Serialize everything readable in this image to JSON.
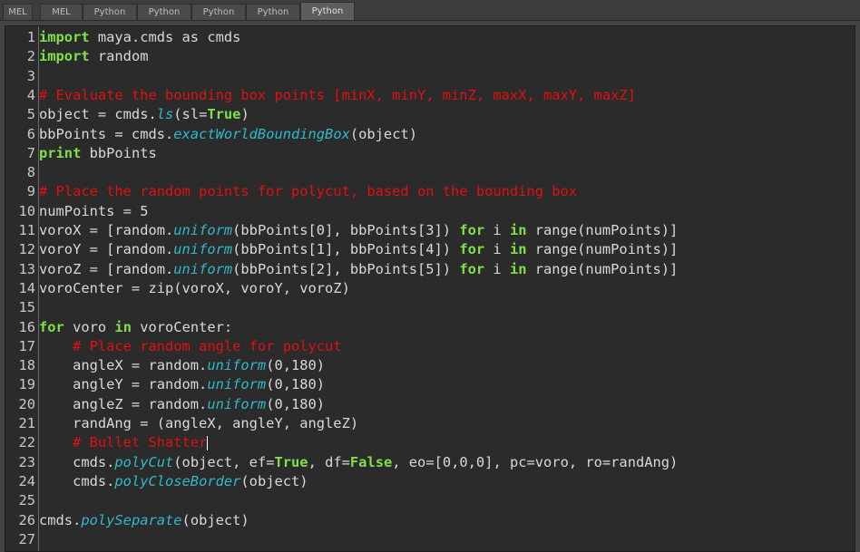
{
  "tabs": [
    {
      "label": "MEL"
    },
    {
      "label": "MEL"
    },
    {
      "label": "Python"
    },
    {
      "label": "Python"
    },
    {
      "label": "Python"
    },
    {
      "label": "Python"
    },
    {
      "label": "Python"
    }
  ],
  "active_tab_index": 6,
  "colors": {
    "keyword": "#7fe049",
    "comment": "#e01010",
    "function": "#2fb9c9",
    "text": "#d9d9d9",
    "background": "#2b2b2b"
  },
  "editor": {
    "lines": [
      {
        "num": "1",
        "tokens": [
          {
            "t": "kw",
            "v": "import"
          },
          {
            "t": "tx",
            "v": " maya.cmds as cmds"
          }
        ]
      },
      {
        "num": "2",
        "tokens": [
          {
            "t": "kw",
            "v": "import"
          },
          {
            "t": "tx",
            "v": " random"
          }
        ]
      },
      {
        "num": "3",
        "tokens": []
      },
      {
        "num": "4",
        "tokens": [
          {
            "t": "cm",
            "v": "# Evaluate the bounding box points [minX, minY, minZ, maxX, maxY, maxZ]"
          }
        ]
      },
      {
        "num": "5",
        "tokens": [
          {
            "t": "tx",
            "v": "object = cmds."
          },
          {
            "t": "fn",
            "v": "ls"
          },
          {
            "t": "tx",
            "v": "(sl="
          },
          {
            "t": "kw",
            "v": "True"
          },
          {
            "t": "tx",
            "v": ")"
          }
        ]
      },
      {
        "num": "6",
        "tokens": [
          {
            "t": "tx",
            "v": "bbPoints = cmds."
          },
          {
            "t": "fn",
            "v": "exactWorldBoundingBox"
          },
          {
            "t": "tx",
            "v": "(object)"
          }
        ]
      },
      {
        "num": "7",
        "tokens": [
          {
            "t": "kw",
            "v": "print"
          },
          {
            "t": "tx",
            "v": " bbPoints"
          }
        ]
      },
      {
        "num": "8",
        "tokens": []
      },
      {
        "num": "9",
        "tokens": [
          {
            "t": "cm",
            "v": "# Place the random points for polycut, based on the bounding box"
          }
        ]
      },
      {
        "num": "10",
        "tokens": [
          {
            "t": "tx",
            "v": "numPoints = 5"
          }
        ]
      },
      {
        "num": "11",
        "tokens": [
          {
            "t": "tx",
            "v": "voroX = [random."
          },
          {
            "t": "fn",
            "v": "uniform"
          },
          {
            "t": "tx",
            "v": "(bbPoints[0], bbPoints[3]) "
          },
          {
            "t": "kw",
            "v": "for"
          },
          {
            "t": "tx",
            "v": " i "
          },
          {
            "t": "kw",
            "v": "in"
          },
          {
            "t": "tx",
            "v": " range(numPoints)]"
          }
        ]
      },
      {
        "num": "12",
        "tokens": [
          {
            "t": "tx",
            "v": "voroY = [random."
          },
          {
            "t": "fn",
            "v": "uniform"
          },
          {
            "t": "tx",
            "v": "(bbPoints[1], bbPoints[4]) "
          },
          {
            "t": "kw",
            "v": "for"
          },
          {
            "t": "tx",
            "v": " i "
          },
          {
            "t": "kw",
            "v": "in"
          },
          {
            "t": "tx",
            "v": " range(numPoints)]"
          }
        ]
      },
      {
        "num": "13",
        "tokens": [
          {
            "t": "tx",
            "v": "voroZ = [random."
          },
          {
            "t": "fn",
            "v": "uniform"
          },
          {
            "t": "tx",
            "v": "(bbPoints[2], bbPoints[5]) "
          },
          {
            "t": "kw",
            "v": "for"
          },
          {
            "t": "tx",
            "v": " i "
          },
          {
            "t": "kw",
            "v": "in"
          },
          {
            "t": "tx",
            "v": " range(numPoints)]"
          }
        ]
      },
      {
        "num": "14",
        "tokens": [
          {
            "t": "tx",
            "v": "voroCenter = zip(voroX, voroY, voroZ)"
          }
        ]
      },
      {
        "num": "15",
        "tokens": []
      },
      {
        "num": "16",
        "tokens": [
          {
            "t": "kw",
            "v": "for"
          },
          {
            "t": "tx",
            "v": " voro "
          },
          {
            "t": "kw",
            "v": "in"
          },
          {
            "t": "tx",
            "v": " voroCenter:"
          }
        ]
      },
      {
        "num": "17",
        "tokens": [
          {
            "t": "tx",
            "v": "    "
          },
          {
            "t": "cm",
            "v": "# Place random angle for polycut"
          }
        ]
      },
      {
        "num": "18",
        "tokens": [
          {
            "t": "tx",
            "v": "    angleX = random."
          },
          {
            "t": "fn",
            "v": "uniform"
          },
          {
            "t": "tx",
            "v": "(0,180)"
          }
        ]
      },
      {
        "num": "19",
        "tokens": [
          {
            "t": "tx",
            "v": "    angleY = random."
          },
          {
            "t": "fn",
            "v": "uniform"
          },
          {
            "t": "tx",
            "v": "(0,180)"
          }
        ]
      },
      {
        "num": "20",
        "tokens": [
          {
            "t": "tx",
            "v": "    angleZ = random."
          },
          {
            "t": "fn",
            "v": "uniform"
          },
          {
            "t": "tx",
            "v": "(0,180)"
          }
        ]
      },
      {
        "num": "21",
        "tokens": [
          {
            "t": "tx",
            "v": "    randAng = (angleX, angleY, angleZ)"
          }
        ]
      },
      {
        "num": "22",
        "tokens": [
          {
            "t": "tx",
            "v": "    "
          },
          {
            "t": "cm",
            "v": "# Bullet Shatter"
          },
          {
            "t": "cursor",
            "v": ""
          }
        ]
      },
      {
        "num": "23",
        "tokens": [
          {
            "t": "tx",
            "v": "    cmds."
          },
          {
            "t": "fn",
            "v": "polyCut"
          },
          {
            "t": "tx",
            "v": "(object, ef="
          },
          {
            "t": "kw",
            "v": "True"
          },
          {
            "t": "tx",
            "v": ", df="
          },
          {
            "t": "kw",
            "v": "False"
          },
          {
            "t": "tx",
            "v": ", eo=[0,0,0], pc=voro, ro=randAng)"
          }
        ]
      },
      {
        "num": "24",
        "tokens": [
          {
            "t": "tx",
            "v": "    cmds."
          },
          {
            "t": "fn",
            "v": "polyCloseBorder"
          },
          {
            "t": "tx",
            "v": "(object)"
          }
        ]
      },
      {
        "num": "25",
        "tokens": []
      },
      {
        "num": "26",
        "tokens": [
          {
            "t": "tx",
            "v": "cmds."
          },
          {
            "t": "fn",
            "v": "polySeparate"
          },
          {
            "t": "tx",
            "v": "(object)"
          }
        ]
      },
      {
        "num": "27",
        "tokens": []
      }
    ]
  }
}
